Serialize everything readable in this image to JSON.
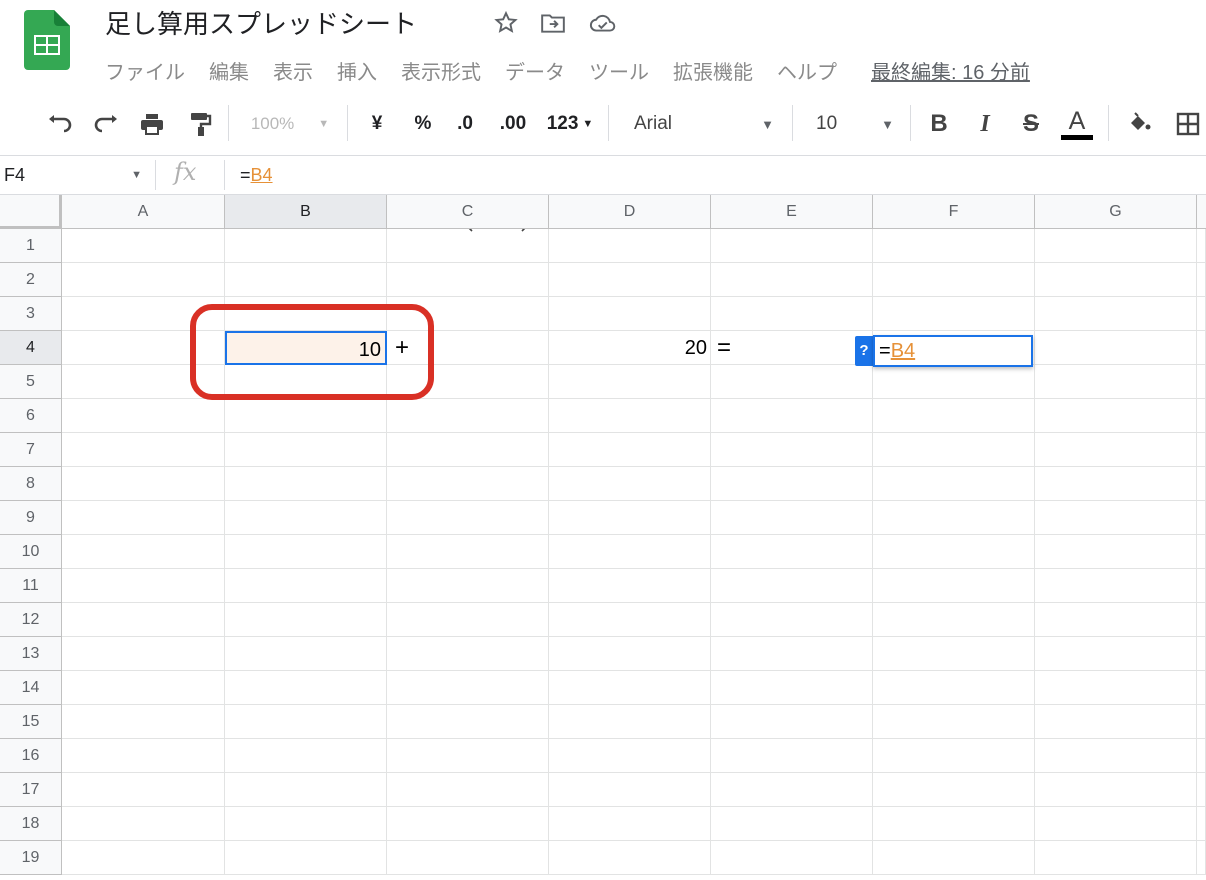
{
  "header": {
    "title": "足し算用スプレッドシート",
    "menu": [
      "ファイル",
      "編集",
      "表示",
      "挿入",
      "表示形式",
      "データ",
      "ツール",
      "拡張機能",
      "ヘルプ"
    ],
    "last_edit": "最終編集: 16 分前",
    "icons": [
      "sheets-logo-icon",
      "star-icon",
      "move-to-folder-icon",
      "cloud-saved-icon"
    ]
  },
  "toolbar": {
    "zoom": "100%",
    "currency": "¥",
    "percent": "%",
    "decrease_decimal": ".0",
    "increase_decimal": ".00",
    "number_format": "123",
    "font": "Arial",
    "font_size": "10",
    "bold": "B",
    "italic": "I",
    "strikethrough": "S",
    "text_color": "A",
    "text_color_value": "#000000"
  },
  "formula_bar": {
    "name_box": "F4",
    "fx": "fx",
    "eq": "=",
    "ref": "B4"
  },
  "grid": {
    "columns": [
      "A",
      "B",
      "C",
      "D",
      "E",
      "F",
      "G"
    ],
    "rows": [
      "1",
      "2",
      "3",
      "4",
      "5",
      "6",
      "7",
      "8",
      "9",
      "10",
      "11",
      "12",
      "13",
      "14",
      "15",
      "16",
      "17",
      "18",
      "19"
    ],
    "selected_column": "B",
    "selected_row": "4",
    "cells": {
      "B4": "10",
      "C4": "+",
      "D4": "20",
      "E4": "=",
      "F4_eq": "=",
      "F4_ref": "B4"
    },
    "help_badge": "?"
  },
  "colors": {
    "accent": "#1a73e8",
    "highlight_box": "#d93025",
    "ref_color": "#e69138",
    "b4_fill": "#fdf2e9"
  }
}
